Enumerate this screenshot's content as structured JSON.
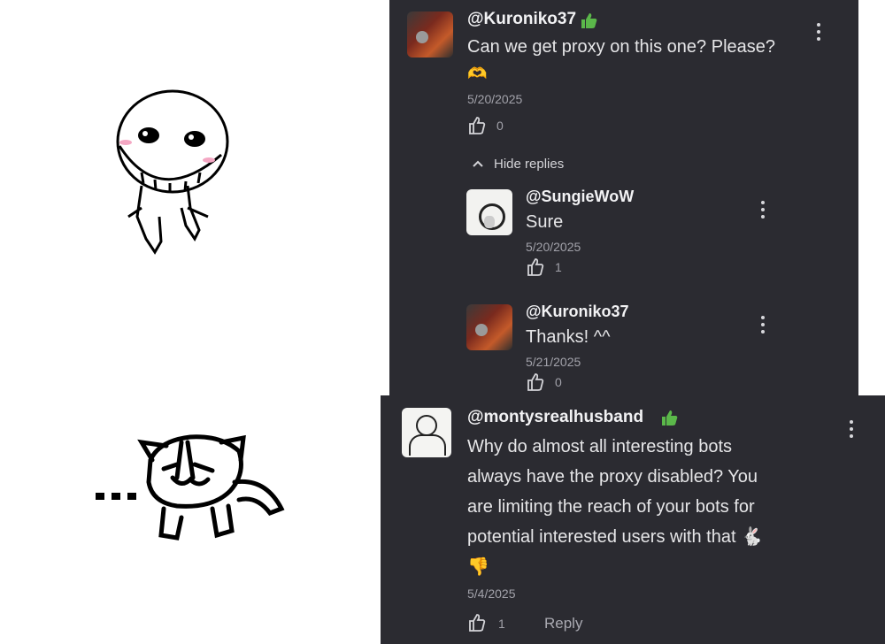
{
  "comments": [
    {
      "username": "@Kuroniko37",
      "badge": "thumbs-up-icon",
      "text": "Can we get proxy on this one? Please?",
      "emoji": "🫶",
      "date": "5/20/2025",
      "likes": "0",
      "hide_replies_label": "Hide replies",
      "replies": [
        {
          "username": "@SungieWoW",
          "text": "Sure",
          "date": "5/20/2025",
          "likes": "1"
        },
        {
          "username": "@Kuroniko37",
          "text": "Thanks! ^^",
          "date": "5/21/2025",
          "likes": "0"
        }
      ]
    },
    {
      "username": "@montysrealhusband",
      "badge": "thumbs-up-icon",
      "text_lines": [
        "Why do almost all interesting bots",
        "always have the proxy disabled? You",
        "are limiting the reach of your bots for",
        "potential interested users with that 🐇"
      ],
      "emoji": "👎",
      "date": "5/4/2025",
      "likes": "1",
      "reply_label": "Reply"
    }
  ],
  "colors": {
    "panel_bg": "#2b2b31",
    "badge_green": "#5bb84a",
    "text": "#e6e6e8",
    "muted": "#a2a2aa"
  }
}
